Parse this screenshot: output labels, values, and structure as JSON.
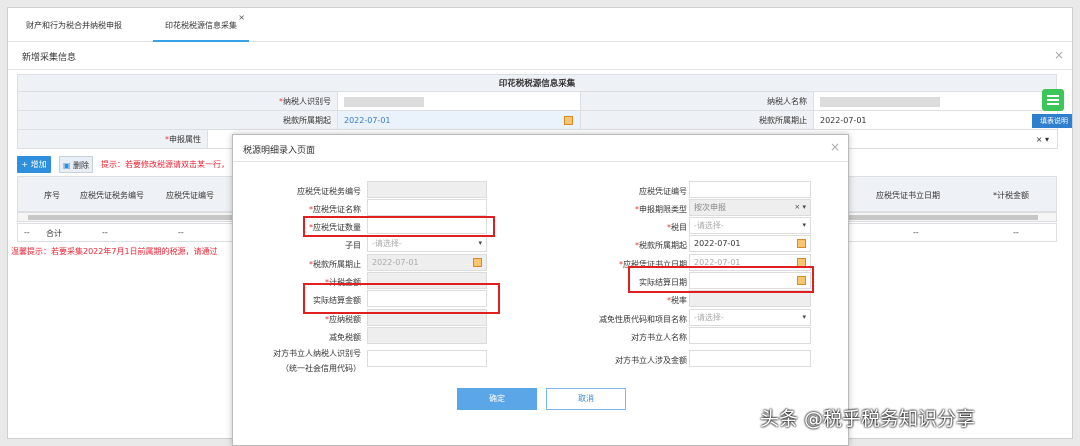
{
  "tabs": [
    {
      "label": "财产和行为税合并纳税申报"
    },
    {
      "label": "印花税税源信息采集",
      "close": "×"
    }
  ],
  "panel": {
    "title": "新增采集信息",
    "close": "×"
  },
  "form": {
    "title": "印花税税源信息采集",
    "taxpayer_id_label": "纳税人识别号",
    "taxpayer_name_label": "纳税人名称",
    "period_start_label": "税款所属期起",
    "period_start": "2022-07-01",
    "period_end_label": "税款所属期止",
    "period_end": "2022-07-01",
    "declare_attr_label": "申报属性",
    "declare_attr_clear": "×",
    "declare_attr_caret": "▾"
  },
  "toolbar": {
    "add": "+ 增加",
    "delete": "删除",
    "tip": "提示：若要修改税源请双击某一行，"
  },
  "grid": {
    "headers": [
      "序号",
      "应税凭证税务编号",
      "应税凭证编号",
      "应税凭证书立日期",
      "*计税金额"
    ],
    "sum_row": [
      "--",
      "合计",
      "--",
      "--",
      "--",
      "--"
    ]
  },
  "warning": "温馨提示：若要采集2022年7月1日前属期的税源，请通过",
  "side": {
    "button": "填表说明"
  },
  "modal": {
    "title": "税源明细录入页面",
    "close": "×",
    "left_labels": [
      "应税凭证税务编号",
      "应税凭证名称",
      "应税凭证数量",
      "子目",
      "税款所属期止",
      "计税金额",
      "实际结算金额",
      "应纳税额",
      "减免税额",
      "对方书立人纳税人识别号",
      "（统一社会信用代码）"
    ],
    "right_labels": [
      "应税凭证编号",
      "申报期限类型",
      "税目",
      "税款所属期起",
      "应税凭证书立日期",
      "实际结算日期",
      "税率",
      "减免性质代码和项目名称",
      "对方书立人名称",
      "对方书立人涉及金额"
    ],
    "subitem_placeholder": "-请选择-",
    "left_period_end": "2022-07-01",
    "period_type_value": "按次申报",
    "period_type_clear": "×",
    "tax_item_placeholder": "-请选择-",
    "right_period_start": "2022-07-01",
    "doc_date_value": "2022-07-01",
    "relief_placeholder": "-请选择-",
    "confirm": "确定",
    "cancel": "取消"
  },
  "watermark": "头条 @税乎税务知识分享",
  "colors": {
    "primary": "#2d8fdd",
    "warning": "#e22323",
    "highlight": "#e02020",
    "header_bg": "#eef1f5"
  }
}
